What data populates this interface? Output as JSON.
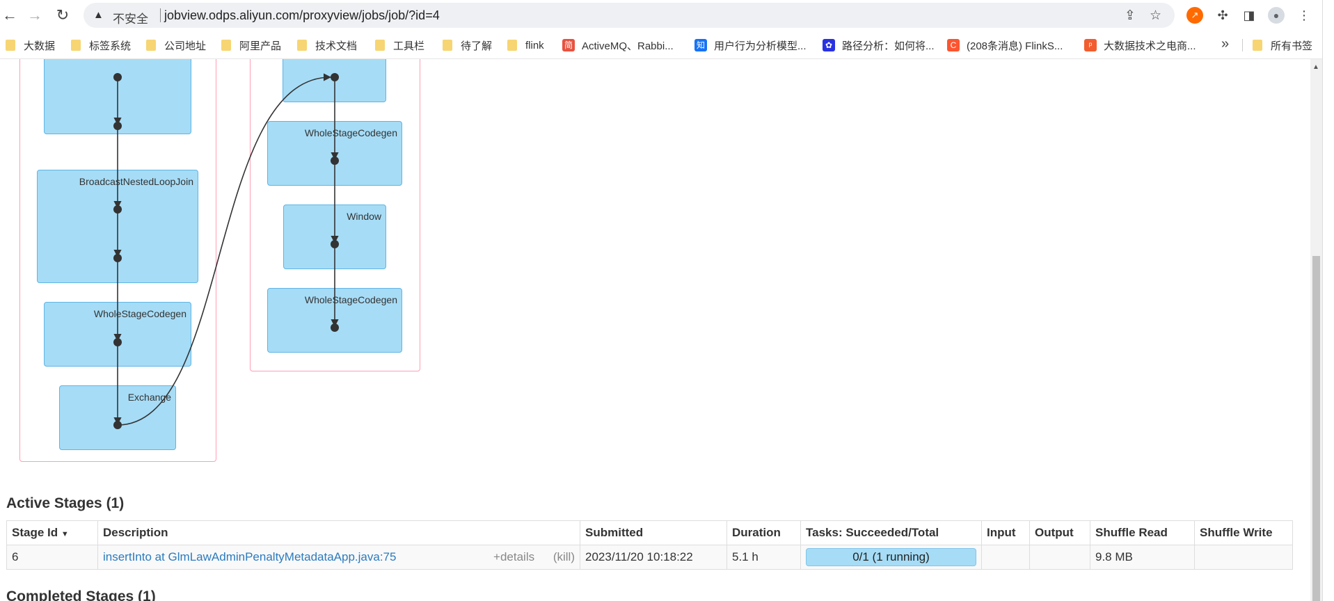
{
  "browser": {
    "insecure_label": "不安全",
    "url": "jobview.odps.aliyun.com/proxyview/jobs/job/?id=4",
    "bookmarks": [
      {
        "label": "大数据",
        "type": "folder"
      },
      {
        "label": "标签系统",
        "type": "folder"
      },
      {
        "label": "公司地址",
        "type": "folder"
      },
      {
        "label": "阿里产品",
        "type": "folder"
      },
      {
        "label": "技术文档",
        "type": "folder"
      },
      {
        "label": "工具栏",
        "type": "folder"
      },
      {
        "label": "待了解",
        "type": "folder"
      },
      {
        "label": "flink",
        "type": "folder"
      },
      {
        "label": "ActiveMQ、Rabbi...",
        "type": "site",
        "icon": "简",
        "color": "#e8523f"
      },
      {
        "label": "用户行为分析模型...",
        "type": "site",
        "icon": "知",
        "color": "#1772f6"
      },
      {
        "label": "路径分析：如何将...",
        "type": "site",
        "icon": "✿",
        "color": "#2932e1"
      },
      {
        "label": "(208条消息) FlinkS...",
        "type": "site",
        "icon": "C",
        "color": "#fc5531"
      },
      {
        "label": "大数据技术之电商...",
        "type": "site",
        "icon": "ᵖ",
        "color": "#f25d2f"
      }
    ],
    "all_bookmarks": "所有书签",
    "more": "»"
  },
  "dag": {
    "left_nodes": [
      "",
      "BroadcastNestedLoopJoin",
      "WholeStageCodegen",
      "Exchange"
    ],
    "right_nodes": [
      "",
      "WholeStageCodegen",
      "Window",
      "WholeStageCodegen"
    ]
  },
  "active_stages": {
    "heading": "Active Stages (1)",
    "columns": [
      "Stage Id",
      "Description",
      "Submitted",
      "Duration",
      "Tasks: Succeeded/Total",
      "Input",
      "Output",
      "Shuffle Read",
      "Shuffle Write"
    ],
    "sort_arrow": "▼",
    "rows": [
      {
        "stage_id": "6",
        "description": "insertInto at GlmLawAdminPenaltyMetadataApp.java:75",
        "details": "+details",
        "kill": "(kill)",
        "submitted": "2023/11/20 10:18:22",
        "duration": "5.1 h",
        "tasks": "0/1 (1 running)",
        "tasks_progress": 0,
        "input": "",
        "output": "",
        "shuffle_read": "9.8 MB",
        "shuffle_write": ""
      }
    ]
  },
  "completed_stages": {
    "heading": "Completed Stages (1)"
  }
}
